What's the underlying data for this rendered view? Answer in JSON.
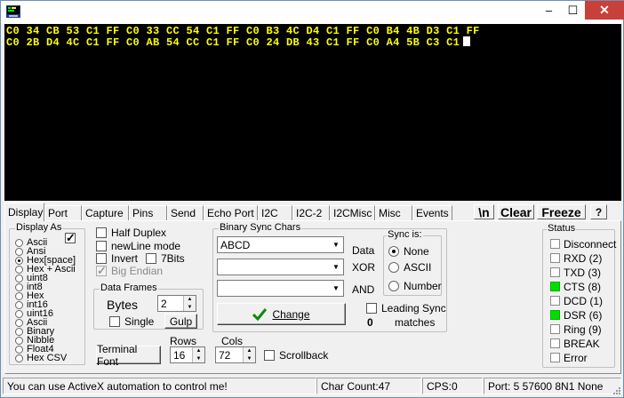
{
  "window": {
    "title": "",
    "minimize": "–",
    "maximize": "☐",
    "close": "✕"
  },
  "terminal": {
    "lines": [
      "C0 34 CB 53 C1 FF C0 33 CC 54 C1 FF C0 B3 4C D4 C1 FF C0 B4 4B D3 C1 FF",
      "C0 2B D4 4C C1 FF C0 AB 54 CC C1 FF C0 24 DB 43 C1 FF C0 A4 5B C3 C1"
    ],
    "text_color": "#ffff00",
    "background": "#000000"
  },
  "tabs": [
    "Display",
    "Port",
    "Capture",
    "Pins",
    "Send",
    "Echo Port",
    "I2C",
    "I2C-2",
    "I2CMisc",
    "Misc",
    "Events"
  ],
  "active_tab": "Display",
  "toolbar": {
    "newline_label": "\\n",
    "clear_label": "Clear",
    "freeze_label": "Freeze",
    "help_label": "?"
  },
  "display_as": {
    "label": "Display As",
    "options": [
      "Ascii",
      "Ansi",
      "Hex[space]",
      "Hex + Ascii",
      "uint8",
      "int8",
      "Hex",
      "int16",
      "uint16",
      "Ascii",
      "Binary",
      "Nibble",
      "Float4",
      "Hex CSV"
    ],
    "selected": "Hex[space]",
    "checkbox_checked": true
  },
  "options": {
    "half_duplex": {
      "label": "Half Duplex",
      "checked": false
    },
    "newline_mode": {
      "label": "newLine mode",
      "checked": false
    },
    "invert": {
      "label": "Invert",
      "checked": false
    },
    "seven_bits": {
      "label": "7Bits",
      "checked": false
    },
    "big_endian": {
      "label": "Big Endian",
      "checked": true,
      "disabled": true
    }
  },
  "data_frames": {
    "label": "Data Frames",
    "bytes_label": "Bytes",
    "bytes_value": "2",
    "single_label": "Single",
    "single_checked": false,
    "gulp_label": "Gulp"
  },
  "terminal_font_label": "Terminal Font",
  "rows": {
    "label": "Rows",
    "value": "16"
  },
  "cols": {
    "label": "Cols",
    "value": "72"
  },
  "scrollback": {
    "label": "Scrollback",
    "checked": false
  },
  "binary_sync": {
    "label": "Binary Sync Chars",
    "data_value": "ABCD",
    "data_label": "Data",
    "xor_value": "",
    "xor_label": "XOR",
    "and_value": "",
    "and_label": "AND",
    "change_label": "Change",
    "leading_sync_label": "Leading Sync",
    "leading_sync_checked": false,
    "matches_count": "0",
    "matches_label": "matches"
  },
  "sync_is": {
    "label": "Sync is:",
    "options": [
      "None",
      "ASCII",
      "Number"
    ],
    "selected": "None"
  },
  "status": {
    "label": "Status",
    "items": [
      {
        "label": "Disconnect",
        "on": false
      },
      {
        "label": "RXD (2)",
        "on": false
      },
      {
        "label": "TXD (3)",
        "on": false
      },
      {
        "label": "CTS (8)",
        "on": true
      },
      {
        "label": "DCD (1)",
        "on": false
      },
      {
        "label": "DSR (6)",
        "on": true
      },
      {
        "label": "Ring (9)",
        "on": false
      },
      {
        "label": "BREAK",
        "on": false
      },
      {
        "label": "Error",
        "on": false
      }
    ],
    "on_color": "#00e000"
  },
  "statusbar": {
    "message": "You can use ActiveX automation to control me!",
    "char_count": "Char Count:47",
    "cps": "CPS:0",
    "port": "Port: 5  57600 8N1 None"
  }
}
